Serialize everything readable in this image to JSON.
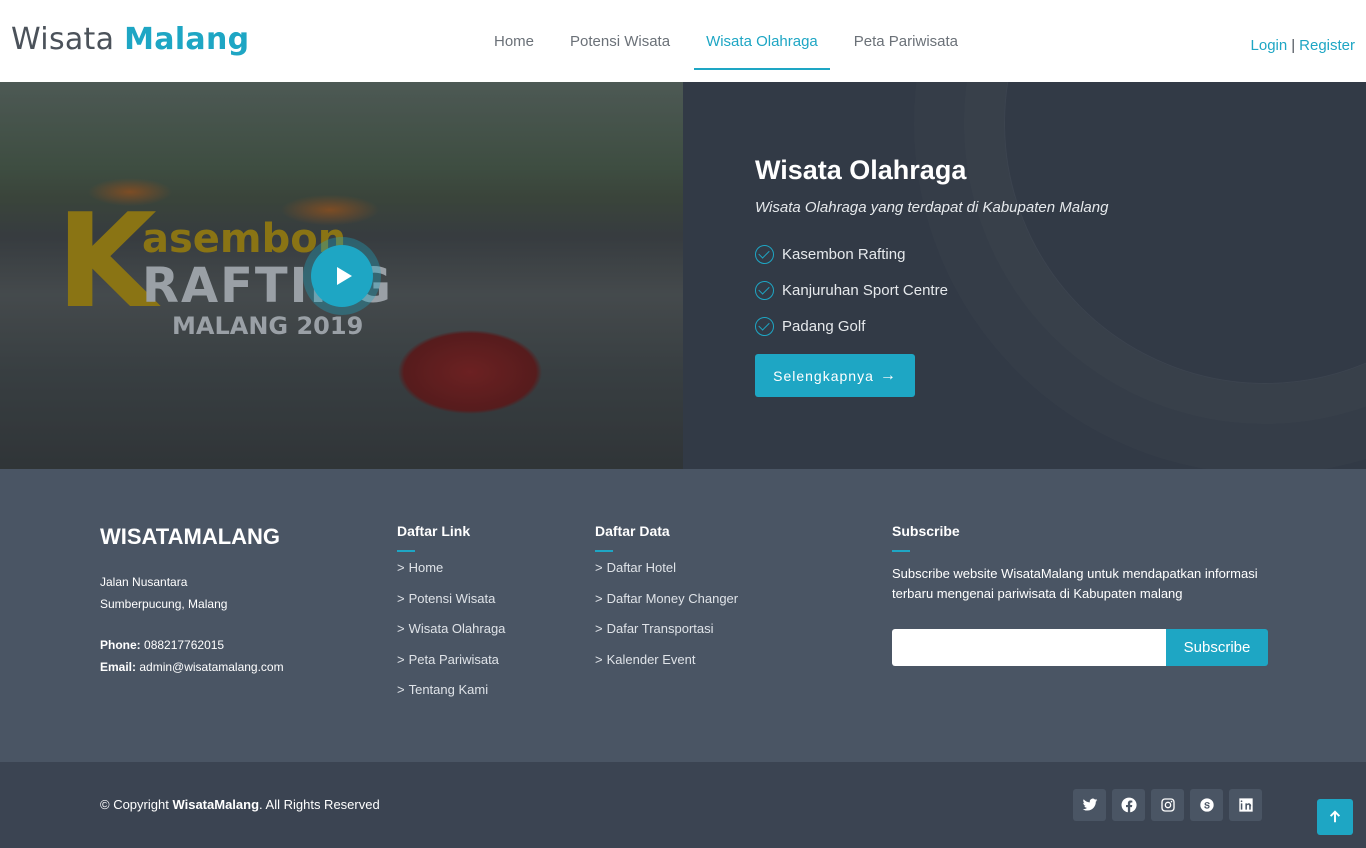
{
  "header": {
    "logo_main": "Wisata",
    "logo_accent": "Malang",
    "nav": [
      {
        "label": "Home",
        "active": false
      },
      {
        "label": "Potensi Wisata",
        "active": false
      },
      {
        "label": "Wisata Olahraga",
        "active": true
      },
      {
        "label": "Peta Pariwisata",
        "active": false
      }
    ],
    "login": "Login",
    "separator": "|",
    "register": "Register"
  },
  "hero": {
    "media": {
      "k_letter": "K",
      "line1": "asembon",
      "line2": "RAFTING",
      "line3": "MALANG 2019"
    },
    "title": "Wisata Olahraga",
    "subtitle": "Wisata Olahraga yang terdapat di Kabupaten Malang",
    "items": [
      "Kasembon Rafting",
      "Kanjuruhan Sport Centre",
      "Padang Golf"
    ],
    "cta_label": "Selengkapnya",
    "cta_arrow": "→"
  },
  "footer": {
    "brand": "WISATAMALANG",
    "address_line1": "Jalan Nusantara",
    "address_line2": "Sumberpucung, Malang",
    "phone_label": "Phone:",
    "phone": "088217762015",
    "email_label": "Email:",
    "email": "admin@wisatamalang.com",
    "links_title": "Daftar Link",
    "links": [
      "Home",
      "Potensi Wisata",
      "Wisata Olahraga",
      "Peta Pariwisata",
      "Tentang Kami"
    ],
    "data_title": "Daftar Data",
    "data_links": [
      "Daftar Hotel",
      "Daftar Money Changer",
      "Dafar Transportasi",
      "Kalender Event"
    ],
    "subscribe_title": "Subscribe",
    "subscribe_text": "Subscribe website WisataMalang untuk mendapatkan informasi terbaru mengenai pariwisata di Kabupaten malang",
    "subscribe_value": "",
    "subscribe_button": "Subscribe",
    "chevron": ">"
  },
  "bottom": {
    "copyright_prefix": "© Copyright",
    "copyright_brand": "WisataMalang",
    "copyright_suffix": ". All Rights Reserved",
    "social": [
      "twitter-icon",
      "facebook-icon",
      "instagram-icon",
      "skype-icon",
      "linkedin-icon"
    ]
  },
  "colors": {
    "accent": "#1ea6c4",
    "hero_dark": "#323a46",
    "footer_top": "#4a5564",
    "footer_bottom": "#3b4452"
  }
}
